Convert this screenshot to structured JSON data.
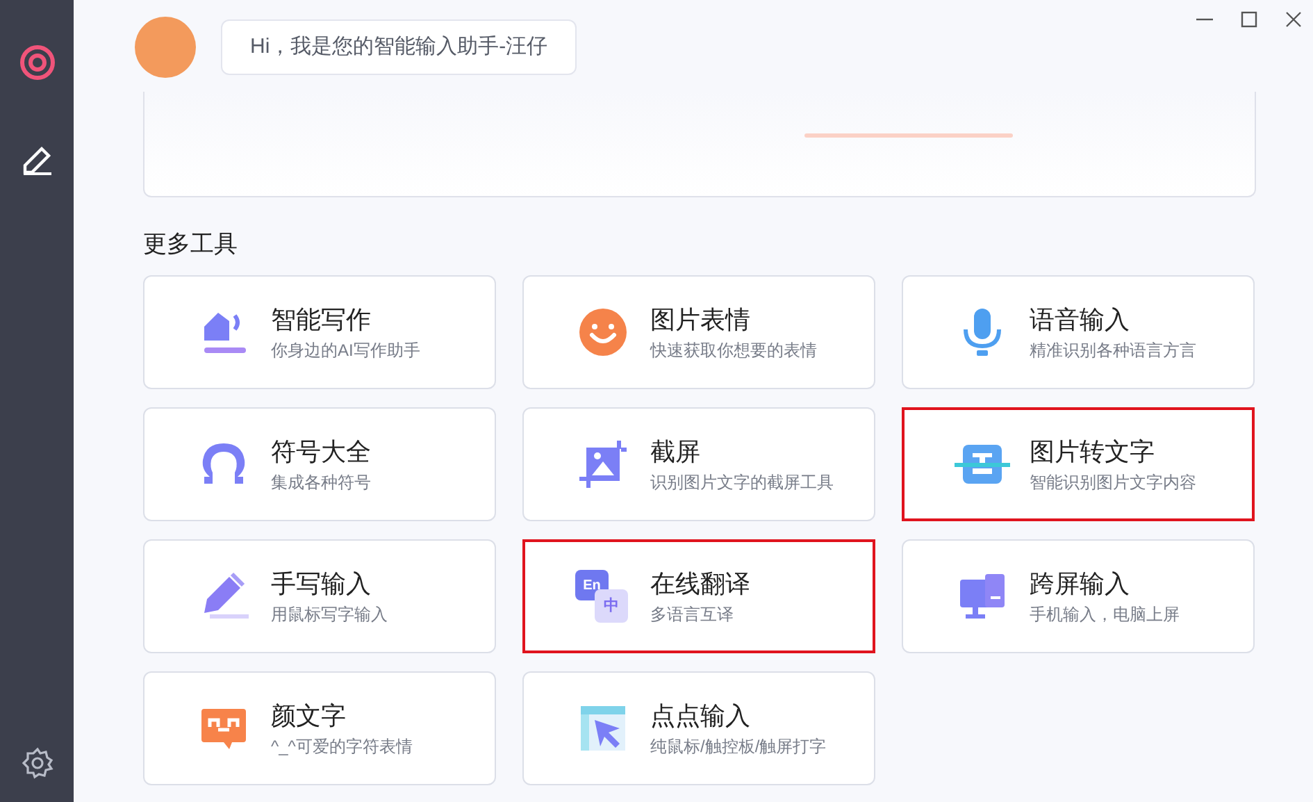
{
  "greeting": {
    "text": "Hi，我是您的智能输入助手-汪仔"
  },
  "section_title": "更多工具",
  "tools": [
    {
      "kind": "pen",
      "title": "智能写作",
      "subtitle": "你身边的AI写作助手",
      "highlighted": false
    },
    {
      "kind": "smile",
      "title": "图片表情",
      "subtitle": "快速获取你想要的表情",
      "highlighted": false
    },
    {
      "kind": "mic",
      "title": "语音输入",
      "subtitle": "精准识别各种语言方言",
      "highlighted": false
    },
    {
      "kind": "omega",
      "title": "符号大全",
      "subtitle": "集成各种符号",
      "highlighted": false
    },
    {
      "kind": "screenshot",
      "title": "截屏",
      "subtitle": "识别图片文字的截屏工具",
      "highlighted": false
    },
    {
      "kind": "ocr",
      "title": "图片转文字",
      "subtitle": "智能识别图片文字内容",
      "highlighted": true
    },
    {
      "kind": "pencil",
      "title": "手写输入",
      "subtitle": "用鼠标写字输入",
      "highlighted": false
    },
    {
      "kind": "translate",
      "title": "在线翻译",
      "subtitle": "多语言互译",
      "highlighted": true,
      "icon_texts": [
        "En",
        "中"
      ]
    },
    {
      "kind": "cross-screen",
      "title": "跨屏输入",
      "subtitle": "手机输入，电脑上屏",
      "highlighted": false
    },
    {
      "kind": "kaomoji",
      "title": "颜文字",
      "subtitle": "^_^可爱的字符表情",
      "highlighted": false
    },
    {
      "kind": "pointer",
      "title": "点点输入",
      "subtitle": "纯鼠标/触控板/触屏打字",
      "highlighted": false
    }
  ]
}
